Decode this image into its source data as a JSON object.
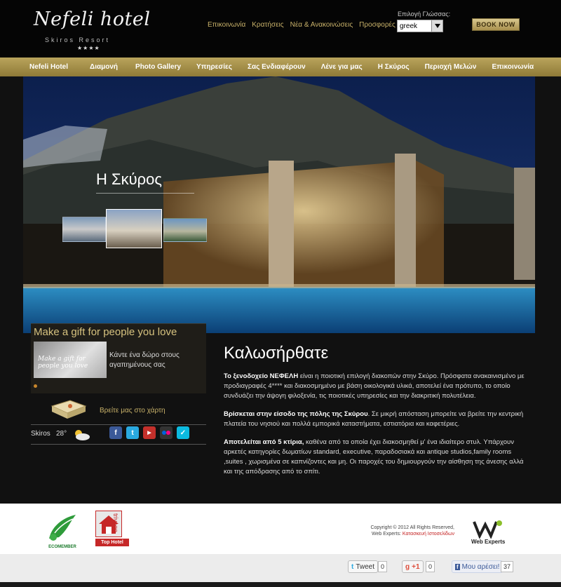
{
  "header": {
    "logo_main": "Nefeli hotel",
    "logo_sub": "Skiros Resort",
    "logo_stars": "★★★★",
    "top_links": [
      "Επικοινωνία",
      "Κρατήσεις",
      "Νέα & Ανακοινώσεις",
      "Προσφορές"
    ],
    "language_label": "Επιλογή Γλώσσας:",
    "language_value": "greek",
    "book_button": "BOOK NOW"
  },
  "nav": {
    "items": [
      "Nefeli Hotel",
      "Διαμονή",
      "Photo Gallery",
      "Υπηρεσίες",
      "Σας Ενδιαφέρουν",
      "Λένε για μας",
      "Η Σκύρος",
      "Περιοχή Μελών",
      "Επικοινωνία"
    ]
  },
  "hero": {
    "title": "Η Σκύρος"
  },
  "gift": {
    "title": "Make a gift for people you love",
    "image_text": "Make a gift for people you love",
    "text": "Κάντε ένα δώρο στους αγαπημένους σας"
  },
  "map": {
    "text": "Βρείτε μας στο χάρτη"
  },
  "weather": {
    "city": "Skiros",
    "temp": "28°"
  },
  "social_icons": [
    "facebook-icon",
    "twitter-icon",
    "youtube-icon",
    "flickr-icon",
    "foursquare-icon"
  ],
  "main": {
    "title": "Καλωσήρθατε",
    "p1_bold": "Το ξενοδοχείο ΝΕΦΕΛΗ",
    "p1_rest": " είναι η ποιοτική επιλογή διακοπών στην Σκύρο. Πρόσφατα ανακαινισμένο με προδιαγραφές 4**** και διακοσμημένο με βάση οικολογικά υλικά, αποτελεί ένα πρότυπο, το οποίο συνδυάζει την άψογη φιλοξενία, τις ποιοτικές υπηρεσίες και την διακριτική πολυτέλεια.",
    "p2_bold": "Βρίσκεται στην είσοδο της πόλης της Σκύρου",
    "p2_rest": ". Σε μικρή απόσταση μπορείτε να βρείτε την κεντρική πλατεία του νησιού και πολλά εμπορικά καταστήματα, εστιατόρια και καφετέριες.",
    "p3_bold": "Αποτελείται από 5 κτίρια,",
    "p3_rest": " καθένα από τα οποία έχει διακοσμηθεί μ' ένα ιδιαίτερο στυλ. Υπάρχουν αρκετές κατηγορίες δωματίων standard, executive, παραδοσιακά και antique studios,family rooms ,suites , χωρισμένα σε καπνίζοντες και μη. Οι παροχές του δημιουργούν την αίσθηση της άνεσης αλλά και της απόδρασης από το σπίτι."
  },
  "footer": {
    "eco_label": "ECOMEMBER",
    "tophotel_label": "Top Hotel",
    "tophotel_brand": "trivago",
    "copyright_line1": "Copyright © 2012 All Rights Reserved,",
    "copyright_line2_prefix": "Web Experts: ",
    "copyright_line2_link": "Κατασκευή Ιστοσελίδων",
    "webexperts_label": "Web Experts"
  },
  "share": {
    "tweet_label": "Tweet",
    "tweet_count": "0",
    "gplus_label": "+1",
    "gplus_count": "0",
    "fb_label": "Μου αρέσει!",
    "fb_count": "37"
  }
}
